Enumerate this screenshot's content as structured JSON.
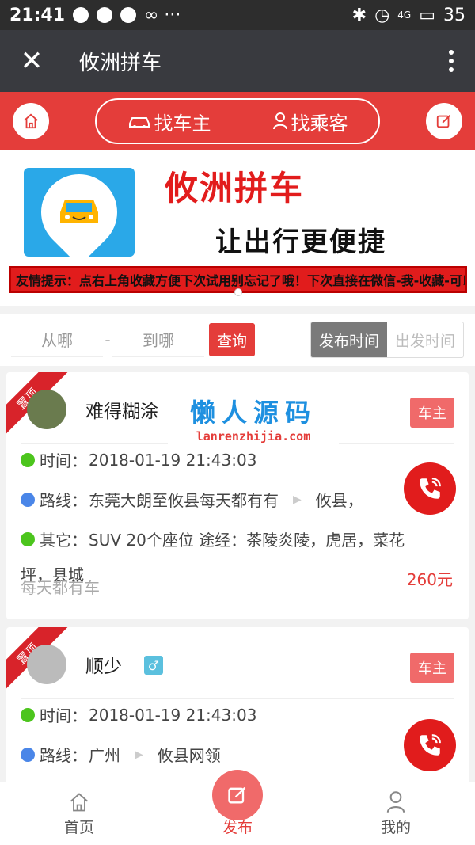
{
  "status": {
    "time": "21:41",
    "signal": "4G",
    "battery": "35"
  },
  "nav": {
    "title": "攸洲拼车",
    "close": "✕"
  },
  "header": {
    "find_owner": "找车主",
    "find_passenger": "找乘客"
  },
  "banner": {
    "title": "攸洲拼车",
    "slogan": "让出行更便捷",
    "tip": "友情提示：点右上角收藏方便下次试用别忘记了哦！下次直接在微信-我-收藏-可以进入"
  },
  "filter": {
    "from_placeholder": "从哪",
    "dash": "-",
    "to_placeholder": "到哪",
    "query": "查询",
    "sort_publish": "发布时间",
    "sort_depart": "出发时间"
  },
  "watermark": {
    "title": "懒人源码",
    "url": "lanrenzhijia.com"
  },
  "listings": [
    {
      "pin": "置顶",
      "user": "难得糊涂",
      "type": "车主",
      "time_label": "时间：",
      "time": "2018-01-19 21:43:03",
      "route_label": "路线：",
      "route_from": "东莞大朗至攸县每天都有有",
      "route_to": "攸县，",
      "other_label": "其它：",
      "other": "SUV  20个座位  途经：茶陵炎陵，虎居，菜花",
      "other_cont": "坪，县城",
      "overlay": "每天都有车",
      "price": "260元"
    },
    {
      "pin": "置顶",
      "user": "顺少",
      "gender": "♂",
      "type": "车主",
      "time_label": "时间：",
      "time": "2018-01-19 21:43:03",
      "route_label": "路线：",
      "route_from": "广州",
      "route_to": "攸县网领"
    }
  ],
  "tabs": {
    "home": "首页",
    "publish": "发布",
    "mine": "我的"
  },
  "colors": {
    "brand_red": "#e43d3a",
    "nav_dark": "#393a3f"
  }
}
